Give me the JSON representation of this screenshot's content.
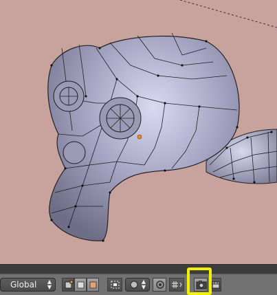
{
  "viewport": {
    "background": "#c8a39e",
    "object_name": "monkey-head-mesh"
  },
  "toolbar": {
    "transform_orientation": "Global",
    "icons": [
      "vertex-select-icon",
      "edge-select-icon",
      "face-select-icon",
      "limit-selection-icon",
      "pivot-point-icon",
      "proportional-edit-icon",
      "snap-icon",
      "snap-target-icon",
      "render-icon",
      "render-anim-icon"
    ]
  },
  "highlight": {
    "color": "#f2f200",
    "target": "render-icon"
  }
}
